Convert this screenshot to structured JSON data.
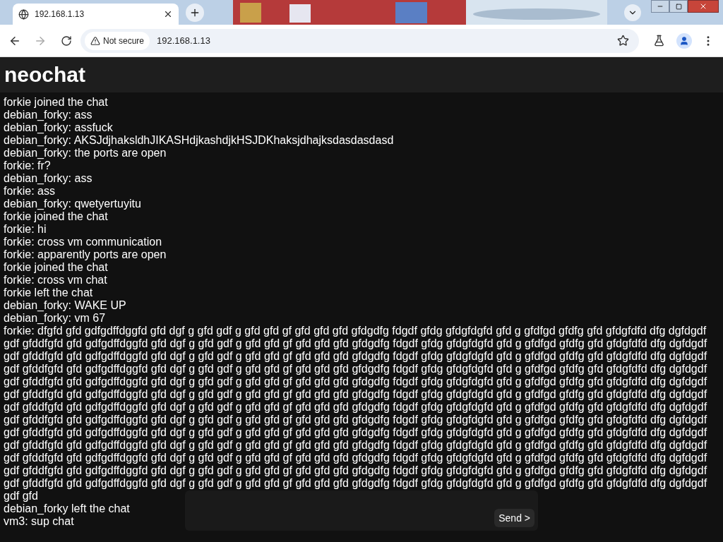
{
  "browser": {
    "tab": {
      "title": "192.168.1.13",
      "selected": true
    },
    "security": "Not secure",
    "url": "192.168.1.13"
  },
  "page": {
    "title": "neochat",
    "messages": [
      "forkie joined the chat",
      "debian_forky: ass",
      "debian_forky: assfuck",
      "debian_forky: AKSJdjhaksldhJIKASHdjkashdjkHSJDKhaksjdhajksdasdasdasd",
      "debian_forky: the ports are open",
      "forkie: fr?",
      "debian_forky: ass",
      "forkie: ass",
      "debian_forky: qwetyertuyitu",
      "forkie joined the chat",
      "forkie: hi",
      "forkie: cross vm communication",
      "forkie: apparently ports are open",
      "forkie joined the chat",
      "forkie: cross vm chat",
      "forkie left the chat",
      "debian_forky: WAKE UP",
      "debian_forky: vm 67",
      "forkie: dfgfd gfd gdfgdffdggfd gfd dgf g gfd gdf g gfd gfd gf gfd gfd gfd gfdgdfg fdgdf gfdg gfdgfdgfd gfd g gfdfgd gfdfg gfd gfdgfdfd dfg dgfdgdf gdf gfddfgfd gfd gdfgdffdggfd gfd dgf g gfd gdf g gfd gfd gf gfd gfd gfd gfdgdfg fdgdf gfdg gfdgfdgfd gfd g gfdfgd gfdfg gfd gfdgfdfd dfg dgfdgdf gdf gfddfgfd gfd gdfgdffdggfd gfd dgf g gfd gdf g gfd gfd gf gfd gfd gfd gfdgdfg fdgdf gfdg gfdgfdgfd gfd g gfdfgd gfdfg gfd gfdgfdfd dfg dgfdgdf gdf gfddfgfd gfd gdfgdffdggfd gfd dgf g gfd gdf g gfd gfd gf gfd gfd gfd gfdgdfg fdgdf gfdg gfdgfdgfd gfd g gfdfgd gfdfg gfd gfdgfdfd dfg dgfdgdf gdf gfddfgfd gfd gdfgdffdggfd gfd dgf g gfd gdf g gfd gfd gf gfd gfd gfd gfdgdfg fdgdf gfdg gfdgfdgfd gfd g gfdfgd gfdfg gfd gfdgfdfd dfg dgfdgdf gdf gfddfgfd gfd gdfgdffdggfd gfd dgf g gfd gdf g gfd gfd gf gfd gfd gfd gfdgdfg fdgdf gfdg gfdgfdgfd gfd g gfdfgd gfdfg gfd gfdgfdfd dfg dgfdgdf gdf gfddfgfd gfd gdfgdffdggfd gfd dgf g gfd gdf g gfd gfd gf gfd gfd gfd gfdgdfg fdgdf gfdg gfdgfdgfd gfd g gfdfgd gfdfg gfd gfdgfdfd dfg dgfdgdf gdf gfddfgfd gfd gdfgdffdggfd gfd dgf g gfd gdf g gfd gfd gf gfd gfd gfd gfdgdfg fdgdf gfdg gfdgfdgfd gfd g gfdfgd gfdfg gfd gfdgfdfd dfg dgfdgdf gdf gfddfgfd gfd gdfgdffdggfd gfd dgf g gfd gdf g gfd gfd gf gfd gfd gfd gfdgdfg fdgdf gfdg gfdgfdgfd gfd g gfdfgd gfdfg gfd gfdgfdfd dfg dgfdgdf gdf gfddfgfd gfd gdfgdffdggfd gfd dgf g gfd gdf g gfd gfd gf gfd gfd gfd gfdgdfg fdgdf gfdg gfdgfdgfd gfd g gfdfgd gfdfg gfd gfdgfdfd dfg dgfdgdf gdf gfddfgfd gfd gdfgdffdggfd gfd dgf g gfd gdf g gfd gfd gf gfd gfd gfd gfdgdfg fdgdf gfdg gfdgfdgfd gfd g gfdfgd gfdfg gfd gfdgfdfd dfg dgfdgdf gdf gfddfgfd gfd gdfgdffdggfd gfd dgf g gfd gdf g gfd gfd gf gfd gfd gfd gfdgdfg fdgdf gfdg gfdgfdgfd gfd g gfdfgd gfdfg gfd gfdgfdfd dfg dgfdgdf gdf gfddfgfd gfd gdfgdffdggfd gfd dgf g gfd gdf g gfd gfd gf gfd gfd gfd gfdgdfg fdgdf gfdg gfdgfdgfd gfd g gfdfgd gfdfg gfd gfdgfdfd dfg dgfdgdf gdf gfd",
      "debian_forky left the chat",
      "vm3: sup chat"
    ],
    "composer": {
      "send": "Send >"
    }
  }
}
